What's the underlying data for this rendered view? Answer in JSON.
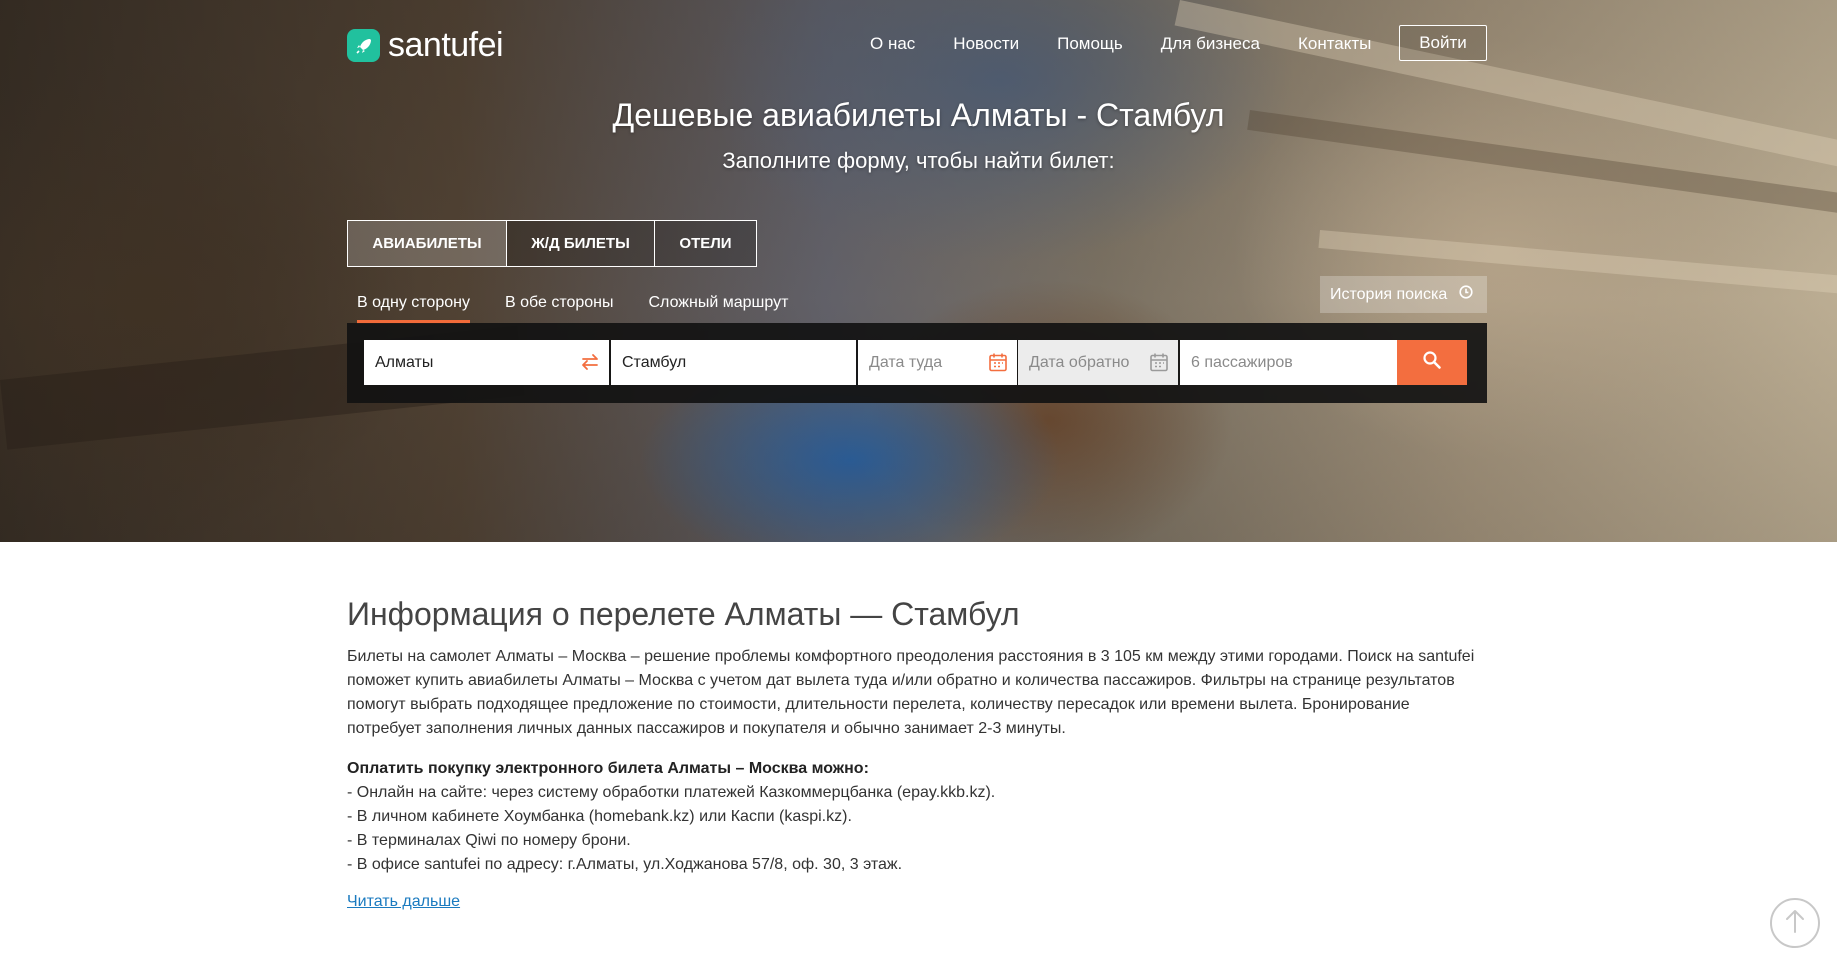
{
  "header": {
    "logo_text": "santufei",
    "nav": [
      "О нас",
      "Новости",
      "Помощь",
      "Для бизнеса",
      "Контакты"
    ],
    "login_label": "Войти"
  },
  "hero": {
    "title": "Дешевые авиабилеты Алматы - Стамбул",
    "subtitle": "Заполните форму, чтобы найти билет:"
  },
  "tabs": [
    "АВИАБИЛЕТЫ",
    "Ж/Д БИЛЕТЫ",
    "ОТЕЛИ"
  ],
  "trip_types": [
    "В одну сторону",
    "В обе стороны",
    "Сложный маршрут"
  ],
  "search_history_label": "История поиска",
  "search": {
    "from_value": "Алматы",
    "to_value": "Стамбул",
    "date_out_placeholder": "Дата туда",
    "date_back_placeholder": "Дата обратно",
    "passengers_placeholder": "6 пассажиров"
  },
  "colors": {
    "accent": "#f36e3f",
    "logo": "#21c19e",
    "link": "#1a7abf"
  },
  "info": {
    "title": "Информация о перелете Алматы — Стамбул",
    "paragraph": "Билеты на самолет Алматы – Москва – решение проблемы комфортного преодоления расстояния в 3 105 км между этими городами. Поиск на santufei поможет купить авиабилеты Алматы – Москва с учетом дат вылета туда и/или обратно и количества пассажиров. Фильтры на странице результатов помогут выбрать подходящее предложение по стоимости, длительности перелета, количеству пересадок или времени вылета. Бронирование потребует заполнения личных данных пассажиров и покупателя и обычно занимает 2-3 минуты.",
    "pay_title": "Оплатить покупку электронного билета Алматы – Москва можно:",
    "pay_lines": [
      "- Онлайн на сайте: через систему обработки платежей Казкоммерцбанка (epay.kkb.kz).",
      "- В личном кабинете Хоумбанка (homebank.kz) или Каспи (kaspi.kz).",
      "- В терминалах Qiwi по номеру брони.",
      "- В офисе santufei по адресу: г.Алматы, ул.Ходжанова 57/8, оф. 30, 3 этаж."
    ],
    "read_more": "Читать дальше"
  }
}
